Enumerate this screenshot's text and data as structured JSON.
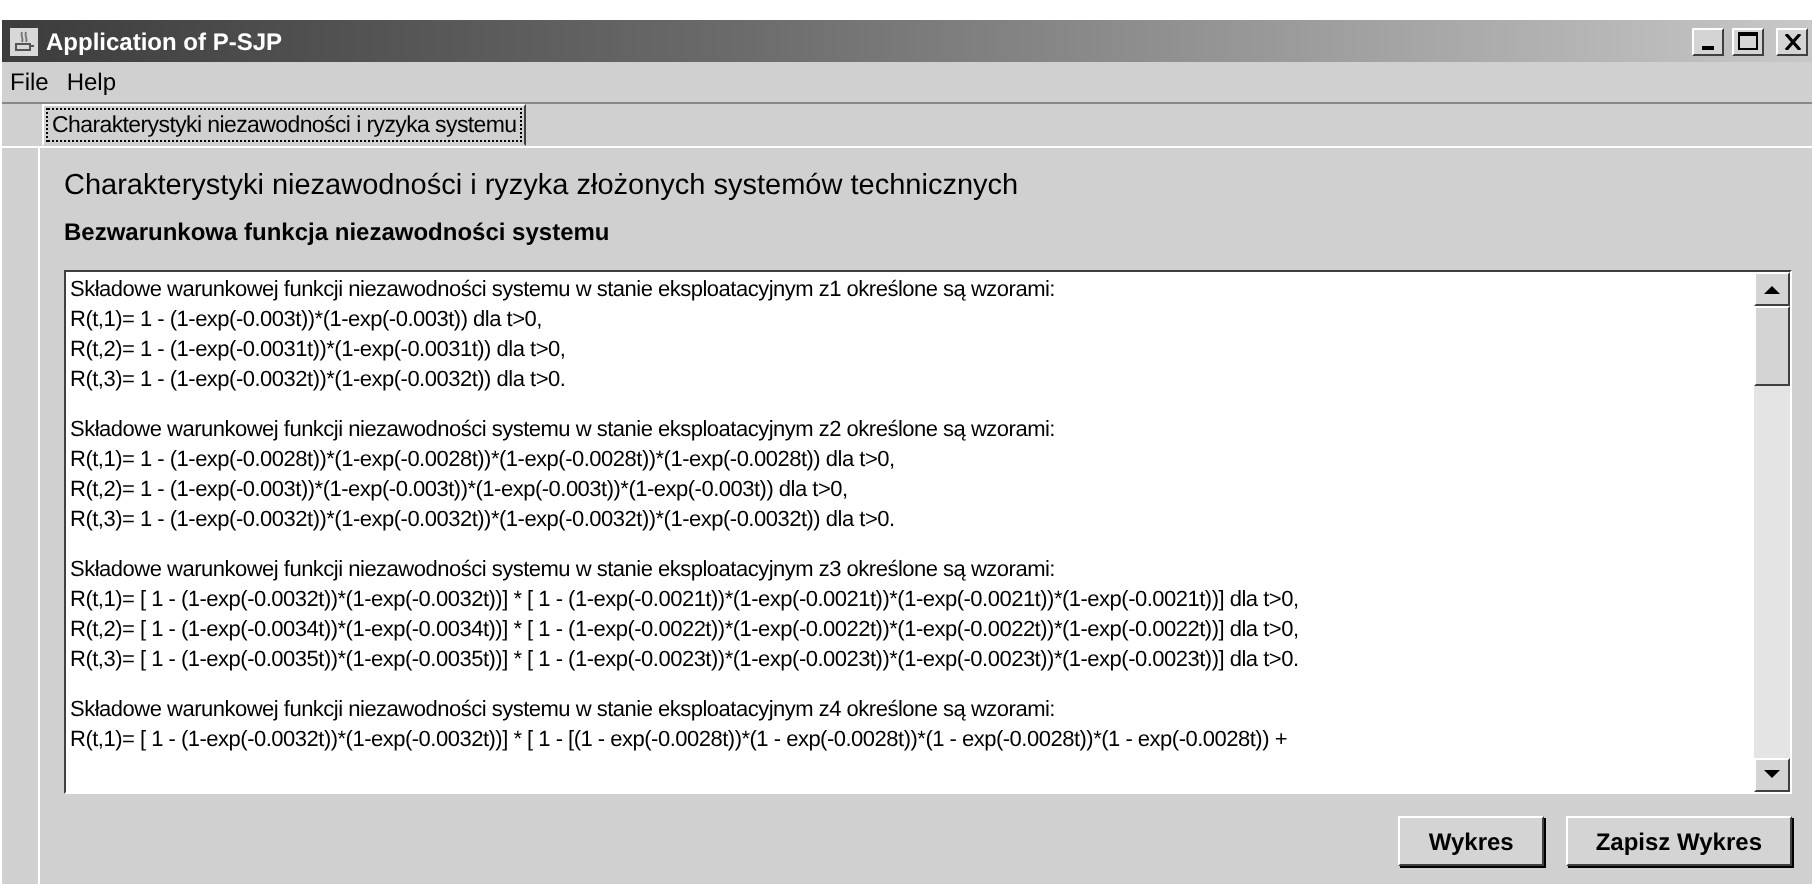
{
  "window": {
    "title": "Application of P-SJP"
  },
  "menu": [
    {
      "label": "File"
    },
    {
      "label": "Help"
    }
  ],
  "tabs": [
    {
      "label": "Charakterystyki niezawodności i ryzyka systemu",
      "selected": true
    }
  ],
  "heading": "Charakterystyki niezawodności i ryzyka złożonych systemów technicznych",
  "subheading": "Bezwarunkowa funkcja niezawodności systemu",
  "text_area": {
    "blocks": [
      {
        "lines": [
          "Składowe warunkowej funkcji niezawodności systemu w stanie eksploatacyjnym z1 określone są wzorami:",
          "R(t,1)= 1 - (1-exp(-0.003t))*(1-exp(-0.003t)) dla t>0,",
          "R(t,2)= 1 - (1-exp(-0.0031t))*(1-exp(-0.0031t)) dla t>0,",
          "R(t,3)= 1 - (1-exp(-0.0032t))*(1-exp(-0.0032t)) dla t>0."
        ]
      },
      {
        "lines": [
          "Składowe warunkowej funkcji niezawodności systemu w stanie eksploatacyjnym z2 określone są wzorami:",
          "R(t,1)= 1 - (1-exp(-0.0028t))*(1-exp(-0.0028t))*(1-exp(-0.0028t))*(1-exp(-0.0028t)) dla t>0,",
          "R(t,2)= 1 - (1-exp(-0.003t))*(1-exp(-0.003t))*(1-exp(-0.003t))*(1-exp(-0.003t)) dla t>0,",
          "R(t,3)= 1 - (1-exp(-0.0032t))*(1-exp(-0.0032t))*(1-exp(-0.0032t))*(1-exp(-0.0032t)) dla t>0."
        ]
      },
      {
        "lines": [
          "Składowe warunkowej funkcji niezawodności systemu w stanie eksploatacyjnym z3 określone są wzorami:",
          "R(t,1)= [ 1 - (1-exp(-0.0032t))*(1-exp(-0.0032t))] * [ 1 - (1-exp(-0.0021t))*(1-exp(-0.0021t))*(1-exp(-0.0021t))*(1-exp(-0.0021t))] dla t>0,",
          "R(t,2)= [ 1 - (1-exp(-0.0034t))*(1-exp(-0.0034t))] * [ 1 - (1-exp(-0.0022t))*(1-exp(-0.0022t))*(1-exp(-0.0022t))*(1-exp(-0.0022t))] dla t>0,",
          "R(t,3)= [ 1 - (1-exp(-0.0035t))*(1-exp(-0.0035t))] * [ 1 - (1-exp(-0.0023t))*(1-exp(-0.0023t))*(1-exp(-0.0023t))*(1-exp(-0.0023t))] dla t>0."
        ]
      },
      {
        "lines": [
          "Składowe warunkowej funkcji niezawodności systemu w stanie eksploatacyjnym z4 określone są wzorami:",
          "R(t,1)= [ 1 - (1-exp(-0.0032t))*(1-exp(-0.0032t))] * [ 1 - [(1 - exp(-0.0028t))*(1 - exp(-0.0028t))*(1 - exp(-0.0028t))*(1 - exp(-0.0028t)) +"
        ]
      }
    ]
  },
  "buttons": [
    {
      "label": "Wykres"
    },
    {
      "label": "Zapisz Wykres"
    }
  ]
}
